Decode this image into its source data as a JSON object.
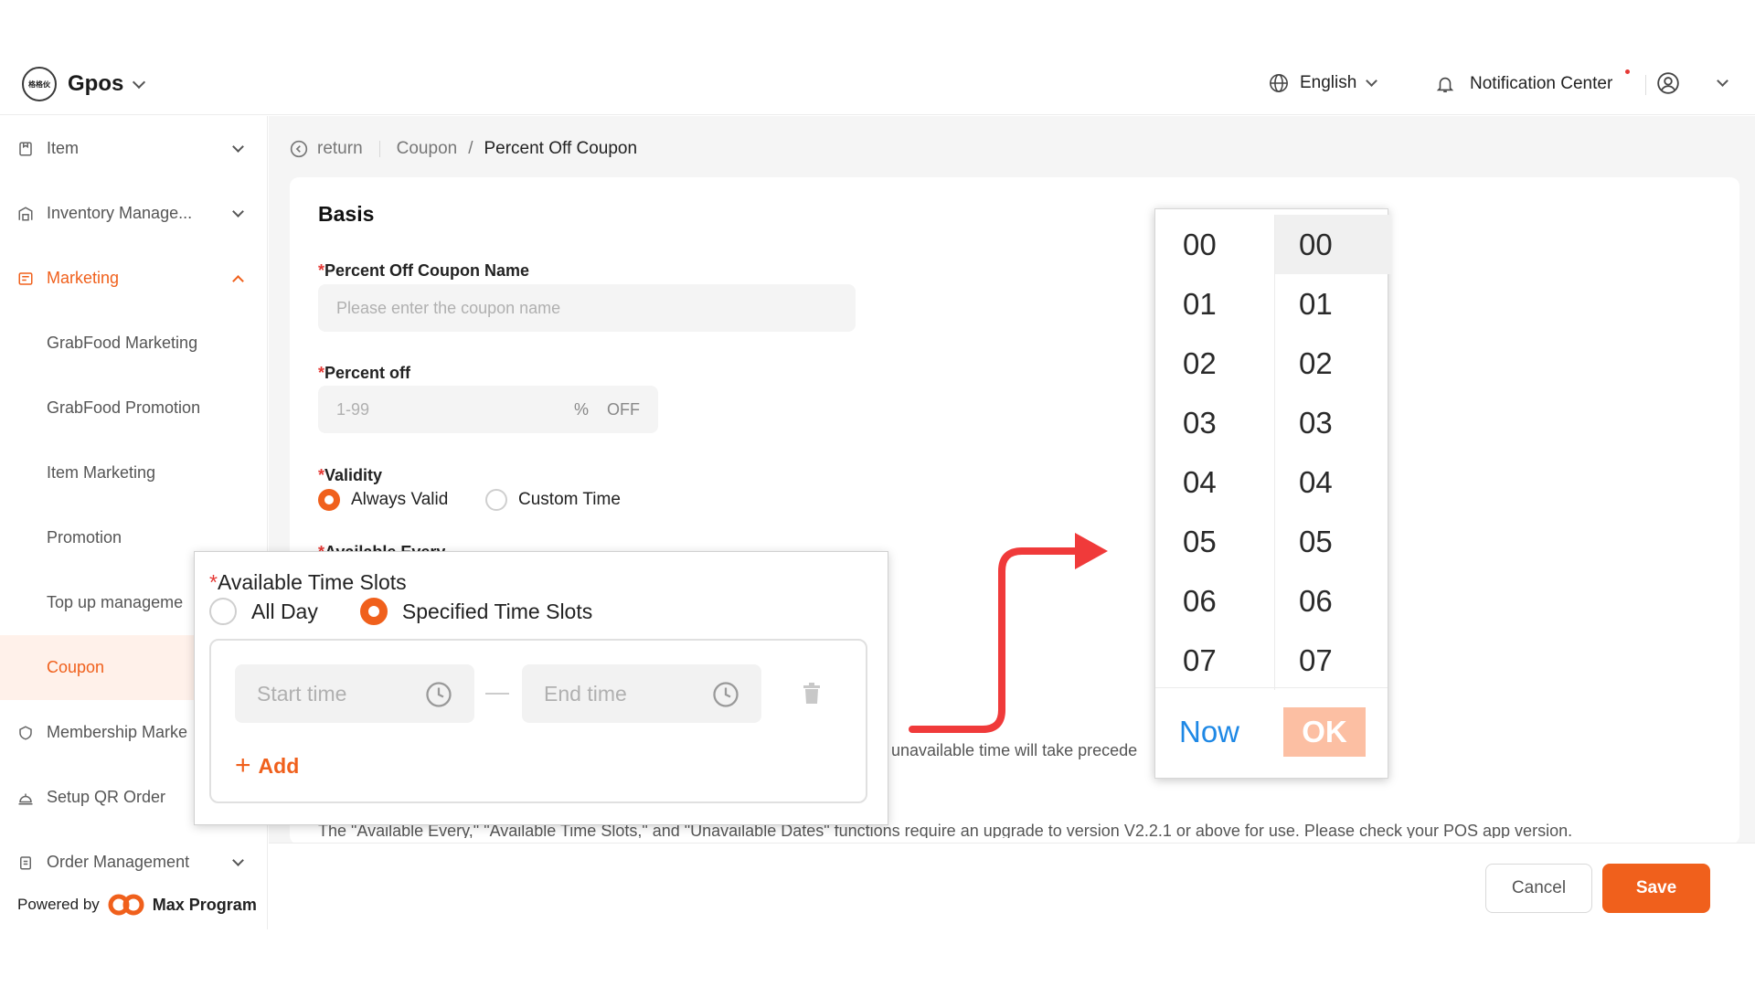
{
  "header": {
    "brand_logo_text": "格格伙",
    "brand_name": "Gpos",
    "language": "English",
    "notification": "Notification Center"
  },
  "sidebar": {
    "items": [
      {
        "label": "Item"
      },
      {
        "label": "Inventory Manage..."
      },
      {
        "label": "Marketing"
      },
      {
        "label": "GrabFood Marketing"
      },
      {
        "label": "GrabFood Promotion"
      },
      {
        "label": "Item Marketing"
      },
      {
        "label": "Promotion"
      },
      {
        "label": "Top up manageme"
      },
      {
        "label": "Coupon"
      },
      {
        "label": "Membership Marke"
      },
      {
        "label": "Setup QR Order"
      },
      {
        "label": "Order Management"
      }
    ],
    "powered_by": "Powered by",
    "powered_brand": "Max Program"
  },
  "breadcrumb": {
    "return": "return",
    "parent": "Coupon",
    "separator": "/",
    "current": "Percent Off Coupon"
  },
  "form": {
    "section_title": "Basis",
    "name_label": "Percent Off Coupon Name",
    "name_placeholder": "Please enter the coupon name",
    "percent_label": "Percent off",
    "percent_placeholder": "1-99",
    "percent_unit": "%",
    "percent_suffix": "OFF",
    "validity_label": "Validity",
    "validity_options": [
      "Always Valid",
      "Custom Time"
    ],
    "validity_selected": "Always Valid",
    "available_every_label": "Available Every",
    "hint_partial": "unavailable time will take precede",
    "version_note": "The \"Available Every,\" \"Available Time Slots,\" and \"Unavailable Dates\" functions require an upgrade to version V2.2.1 or above for use. Please check your POS app version."
  },
  "zoom_popup": {
    "title": "Available Time Slots",
    "options": [
      "All Day",
      "Specified Time Slots"
    ],
    "selected": "Specified Time Slots",
    "start_placeholder": "Start time",
    "end_placeholder": "End time",
    "add_label": "Add"
  },
  "time_picker": {
    "hours": [
      "00",
      "01",
      "02",
      "03",
      "04",
      "05",
      "06",
      "07"
    ],
    "minutes": [
      "00",
      "01",
      "02",
      "03",
      "04",
      "05",
      "06",
      "07"
    ],
    "selected_minute": "00",
    "now_label": "Now",
    "ok_label": "OK"
  },
  "footer": {
    "cancel": "Cancel",
    "save": "Save"
  },
  "colors": {
    "accent": "#f0601c",
    "accent_light": "#fff1ea",
    "link_blue": "#1e88e5",
    "required": "#e53935",
    "arrow": "#f03a3a"
  }
}
